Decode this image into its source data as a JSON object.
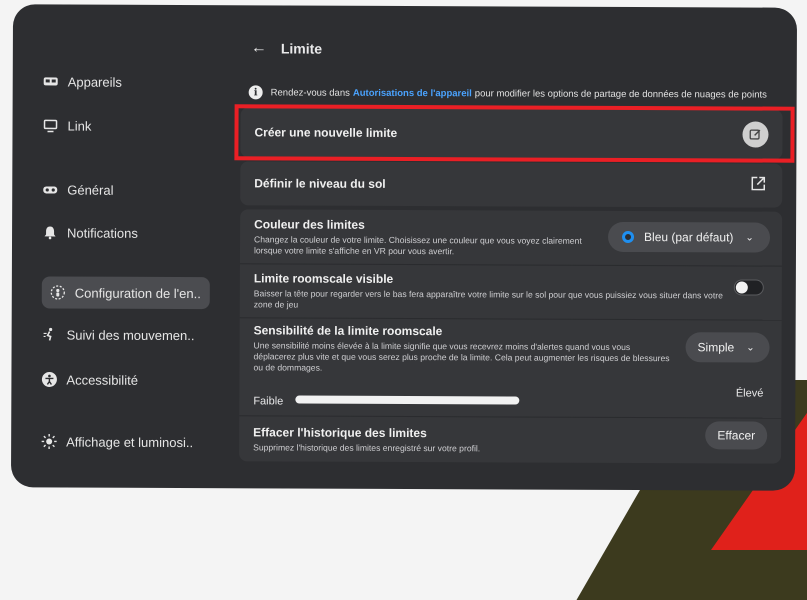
{
  "header": {
    "back_icon": "arrow-left-icon",
    "title": "Limite"
  },
  "sidebar": {
    "items": [
      {
        "label": "Appareils",
        "icon": "headset-device-icon"
      },
      {
        "label": "Link",
        "icon": "link-cast-icon"
      },
      {
        "label": "Général",
        "icon": "vr-goggles-icon"
      },
      {
        "label": "Notifications",
        "icon": "bell-icon"
      },
      {
        "label": "Configuration de l'en..",
        "icon": "boundary-settings-icon"
      },
      {
        "label": "Suivi des mouvemen..",
        "icon": "motion-tracking-icon"
      },
      {
        "label": "Accessibilité",
        "icon": "accessibility-icon"
      },
      {
        "label": "Affichage et luminosi..",
        "icon": "sun-brightness-icon"
      }
    ],
    "active_index": 4
  },
  "info": {
    "prefix": "Rendez-vous dans",
    "link": "Autorisations de l'appareil",
    "suffix": "pour modifier les options de partage de données de nuages de points"
  },
  "settings": {
    "create": {
      "title": "Créer une nouvelle limite",
      "icon": "edit-square-icon"
    },
    "floor": {
      "title": "Définir le niveau du sol",
      "icon": "open-external-icon"
    },
    "color": {
      "title": "Couleur des limites",
      "desc": "Changez la couleur de votre limite. Choisissez une couleur que vous voyez clairement lorsque votre limite s'affiche en VR pour vous avertir.",
      "value": "Bleu (par défaut)",
      "accent": "#1f8ff0"
    },
    "roomscale_visible": {
      "title": "Limite roomscale visible",
      "desc": "Baisser la tête pour regarder vers le bas fera apparaître votre limite sur le sol pour que vous puissiez vous situer dans votre zone de jeu",
      "enabled": false
    },
    "sensitivity": {
      "title": "Sensibilité de la limite roomscale",
      "desc": "Une sensibilité moins élevée à la limite signifie que vous recevrez moins d'alertes quand vous vous déplacerez plus vite et que vous serez plus proche de la limite. Cela peut augmenter les risques de blessures ou de dommages.",
      "value": "Simple",
      "min_label": "Faible",
      "max_label": "Élevé"
    },
    "history": {
      "title": "Effacer l'historique des limites",
      "desc": "Supprimez l'historique des limites enregistré sur votre profil.",
      "button": "Effacer"
    }
  },
  "colors": {
    "highlight": "#ea1f25",
    "link": "#4aa3ff"
  }
}
